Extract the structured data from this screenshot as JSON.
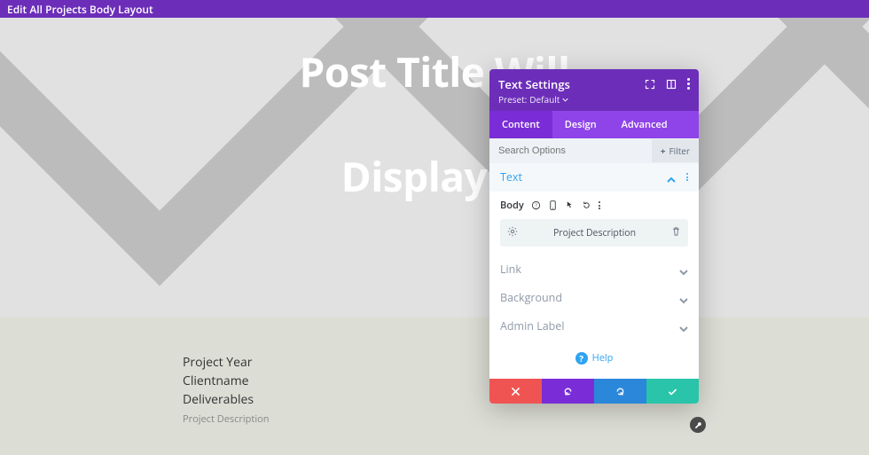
{
  "topbar": {
    "title": "Edit All Projects Body Layout"
  },
  "hero": {
    "line1": "Post Title Will",
    "line2": "Display H"
  },
  "meta": {
    "l1": "Project Year",
    "l2": "Clientname",
    "l3": "Deliverables",
    "desc": "Project Description"
  },
  "panel": {
    "title": "Text Settings",
    "preset_label": "Preset:",
    "preset_value": "Default",
    "tabs": {
      "content": "Content",
      "design": "Design",
      "advanced": "Advanced"
    },
    "search_placeholder": "Search Options",
    "filter_label": "Filter",
    "sections": {
      "text": "Text",
      "link": "Link",
      "background": "Background",
      "admin": "Admin Label"
    },
    "body_label": "Body",
    "field_value": "Project Description",
    "help": "Help"
  }
}
